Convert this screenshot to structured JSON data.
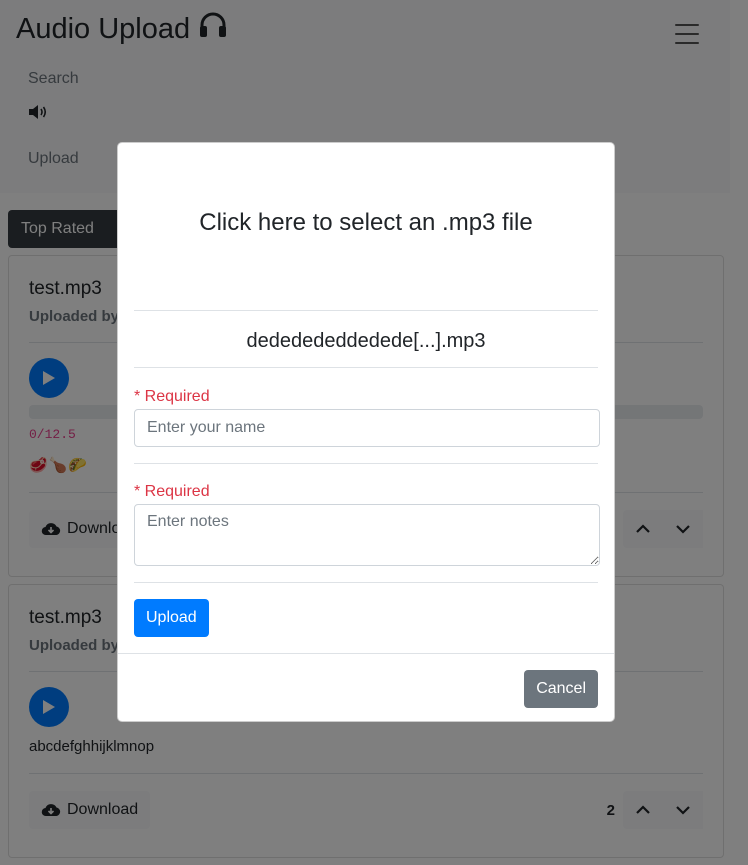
{
  "navbar": {
    "title": "Audio Upload",
    "links": {
      "search": "Search",
      "upload": "Upload"
    },
    "icons": {
      "title_icon": "headphones-icon",
      "menu_icon": "hamburger-menu-icon",
      "speaker_icon": "speaker-icon"
    }
  },
  "tabs": {
    "active": "Top Rated"
  },
  "cards": [
    {
      "title": "test.mp3",
      "uploaded_by": "Uploaded by",
      "time": "0/12.5",
      "emojis": "🥩🍗🌮",
      "download": "Download",
      "votes": ""
    },
    {
      "title": "test.mp3",
      "uploaded_by": "Uploaded by",
      "notes": "abcdefghhijklmnop",
      "download": "Download",
      "votes": "2"
    }
  ],
  "modal": {
    "select_file": "Click here to select an .mp3 file",
    "filename": "dededededdedede[...].mp3",
    "name_required": "* Required",
    "name_placeholder": "Enter your name",
    "notes_required": "* Required",
    "notes_placeholder": "Enter notes",
    "upload_label": "Upload",
    "cancel_label": "Cancel"
  },
  "colors": {
    "primary": "#007bff",
    "danger": "#dc3545",
    "secondary": "#6c757d",
    "dark": "#343a40"
  }
}
